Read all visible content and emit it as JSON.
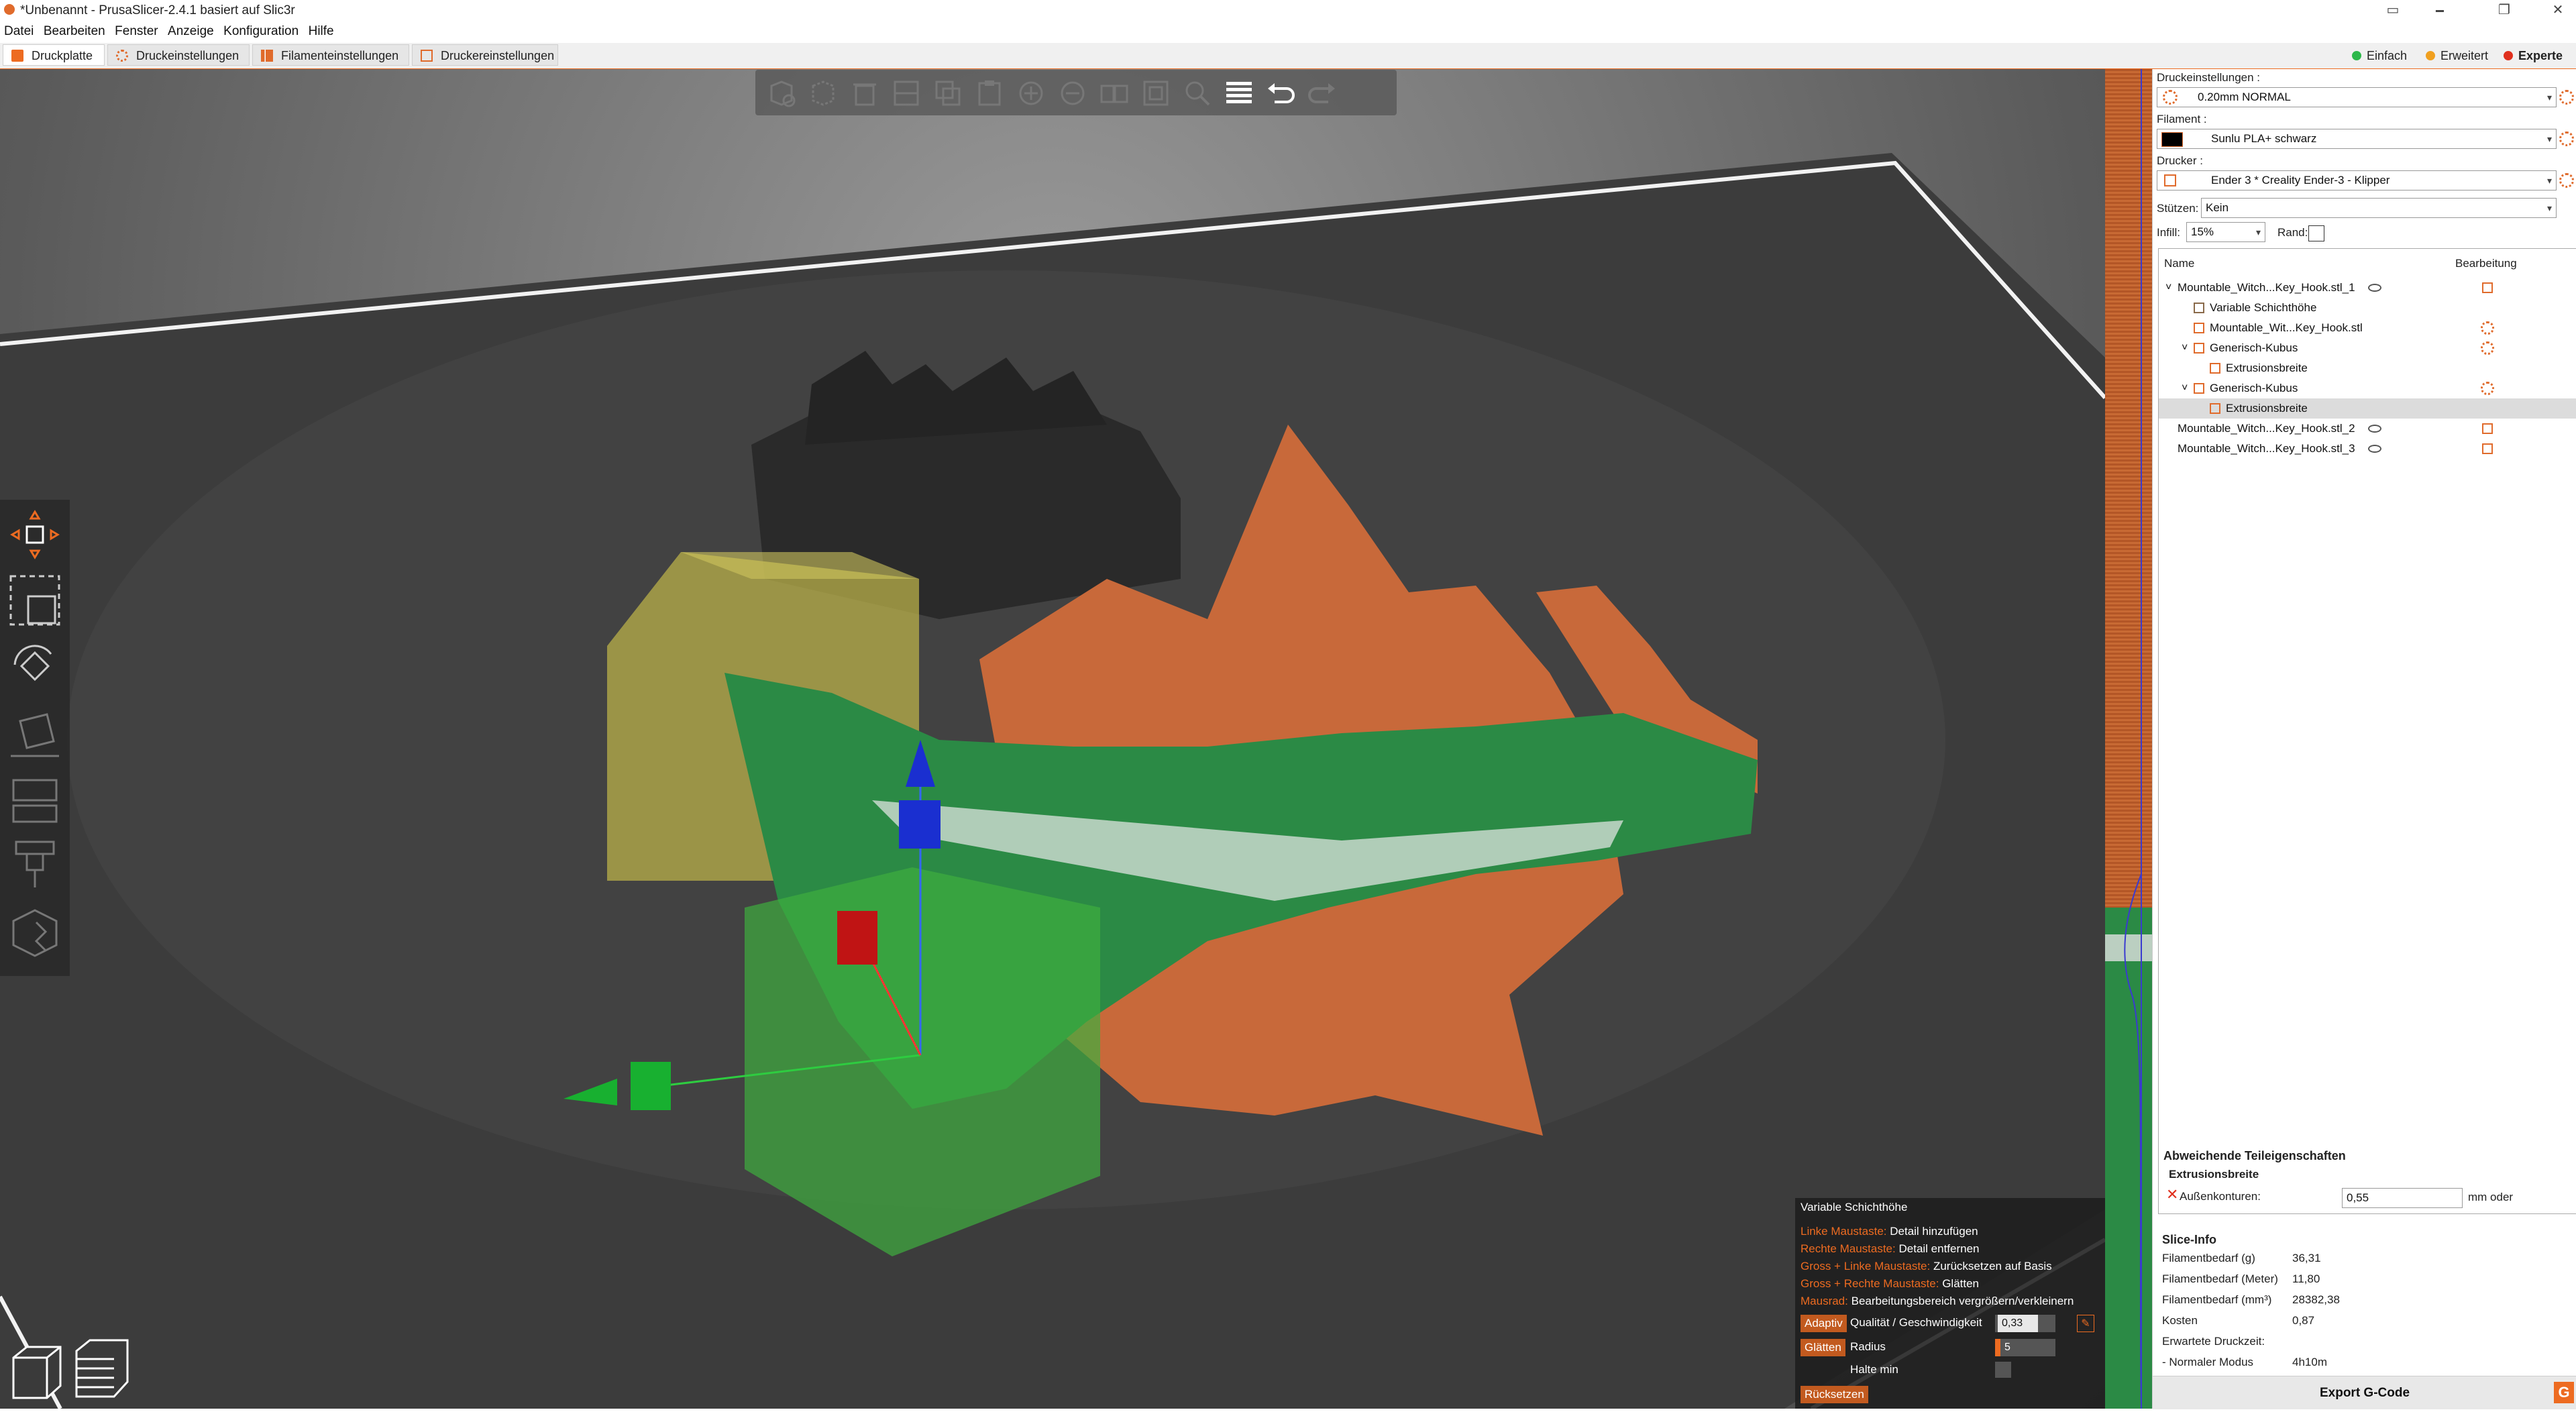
{
  "window": {
    "title": "*Unbenannt - PrusaSlicer-2.4.1 basiert auf Slic3r",
    "controls": [
      "▭",
      "🗕",
      "❐",
      "✕"
    ]
  },
  "menu": [
    "Datei",
    "Bearbeiten",
    "Fenster",
    "Anzeige",
    "Konfiguration",
    "Hilfe"
  ],
  "tabs": [
    "Druckplatte",
    "Druckeinstellungen",
    "Filamenteinstellungen",
    "Druckereinstellungen"
  ],
  "modes": [
    "Einfach",
    "Erweitert",
    "Experte"
  ],
  "colors": {
    "accent": "#ed6b21",
    "einfach": "#2db84b",
    "erweitert": "#f0a020",
    "experte": "#e0301e",
    "model_orange": "#c8693a",
    "model_green": "#2b8a45"
  },
  "toolbar_icons": [
    "add-icon",
    "delete-icon",
    "delete-all-icon",
    "arrange-icon",
    "copy-icon",
    "paste-icon",
    "add-instance-icon",
    "remove-instance-icon",
    "split-objects-icon",
    "split-parts-icon",
    "search-icon",
    "layers-editing-icon",
    "undo-icon",
    "redo-icon"
  ],
  "panel": {
    "print_settings_label": "Druckeinstellungen :",
    "print_settings_value": "0.20mm NORMAL",
    "filament_label": "Filament :",
    "filament_value": "Sunlu PLA+ schwarz",
    "printer_label": "Drucker :",
    "printer_value": "Ender 3 * Creality Ender-3 - Klipper",
    "supports_label": "Stützen:",
    "supports_value": "Kein",
    "infill_label": "Infill:",
    "infill_value": "15%",
    "brim_label": "Rand:",
    "col_name": "Name",
    "col_edit": "Bearbeitung",
    "objects": [
      {
        "label": "Mountable_Witch...Key_Hook.stl_1",
        "indent": 0,
        "expand": "˅"
      },
      {
        "label": "Variable Schichthöhe",
        "indent": 1,
        "expand": ""
      },
      {
        "label": "Mountable_Wit...Key_Hook.stl",
        "indent": 1,
        "expand": ""
      },
      {
        "label": "Generisch-Kubus",
        "indent": 1,
        "expand": "˅"
      },
      {
        "label": "Extrusionsbreite",
        "indent": 2,
        "expand": ""
      },
      {
        "label": "Generisch-Kubus",
        "indent": 1,
        "expand": "˅"
      },
      {
        "label": "Extrusionsbreite",
        "indent": 2,
        "expand": ""
      },
      {
        "label": "Mountable_Witch...Key_Hook.stl_2",
        "indent": 0,
        "expand": ""
      },
      {
        "label": "Mountable_Witch...Key_Hook.stl_3",
        "indent": 0,
        "expand": ""
      }
    ],
    "part_props_title": "Abweichende Teileigenschaften",
    "part_props_sub": "Extrusionsbreite",
    "perimeters_label": "Außenkonturen:",
    "perimeters_value": "0,55",
    "perimeters_unit": "mm oder",
    "slice_info_title": "Slice-Info",
    "slice_info": [
      {
        "k": "Filamentbedarf (g)",
        "v": "36,31"
      },
      {
        "k": "Filamentbedarf (Meter)",
        "v": "11,80"
      },
      {
        "k": "Filamentbedarf (mm³)",
        "v": "28382,38"
      },
      {
        "k": "Kosten",
        "v": "0,87"
      },
      {
        "k": "Erwartete Druckzeit:",
        "v": ""
      },
      {
        "k": "- Normaler Modus",
        "v": "4h10m"
      }
    ],
    "export_label": "Export G-Code"
  },
  "legend": {
    "title": "Variable Schichthöhe",
    "rows": [
      {
        "k": "Linke Maustaste:",
        "v": "Detail hinzufügen"
      },
      {
        "k": "Rechte Maustaste:",
        "v": "Detail entfernen"
      },
      {
        "k": "Gross + Linke Maustaste:",
        "v": "Zurücksetzen auf Basis"
      },
      {
        "k": "Gross + Rechte Maustaste:",
        "v": "Glätten"
      },
      {
        "k": "Mausrad:",
        "v": "Bearbeitungsbereich vergrößern/verkleinern"
      }
    ],
    "adaptive_label": "Adaptiv",
    "quality_label": "Qualität / Geschwindigkeit",
    "quality_value": "0,33",
    "smooth_label": "Glätten",
    "radius_label": "Radius",
    "radius_value": "5",
    "keep_min_label": "Halte min",
    "reset_label": "Rücksetzen"
  }
}
